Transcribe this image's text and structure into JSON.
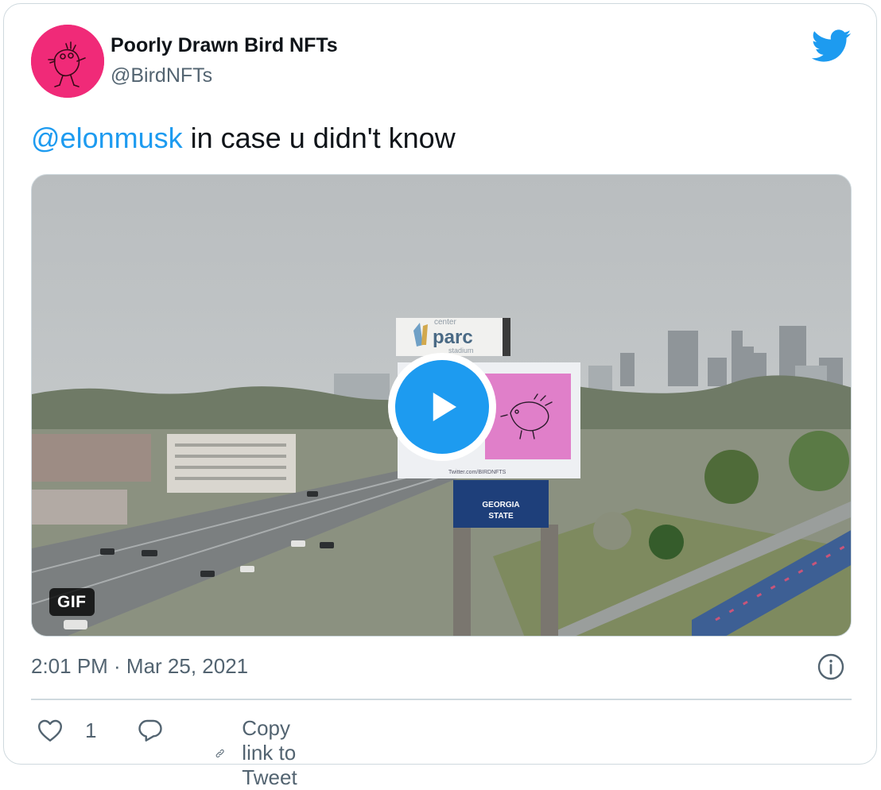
{
  "author": {
    "display_name": "Poorly Drawn Bird NFTs",
    "handle": "@BirdNFTs",
    "avatar_color": "#f02a78"
  },
  "tweet": {
    "mention": "@elonmusk",
    "text": " in case u didn't know"
  },
  "media": {
    "badge": "GIF",
    "billboard_sign": "parc",
    "billboard_sign_top": "center",
    "billboard_sign_bottom": "stadium",
    "billboard_url": "Twitter.com/BIRDNFTS",
    "billboard_lower_line1": "GEORGIA",
    "billboard_lower_line2": "STATE"
  },
  "footer": {
    "timestamp": "2:01 PM · Mar 25, 2021",
    "like_count": "1",
    "copy_link_label": "Copy link to Tweet"
  },
  "colors": {
    "accent": "#1d9bf0",
    "secondary_text": "#536471",
    "border": "#cfd9de"
  },
  "icons": [
    "twitter-bird-icon",
    "play-icon",
    "info-icon",
    "heart-icon",
    "reply-icon",
    "link-icon"
  ]
}
